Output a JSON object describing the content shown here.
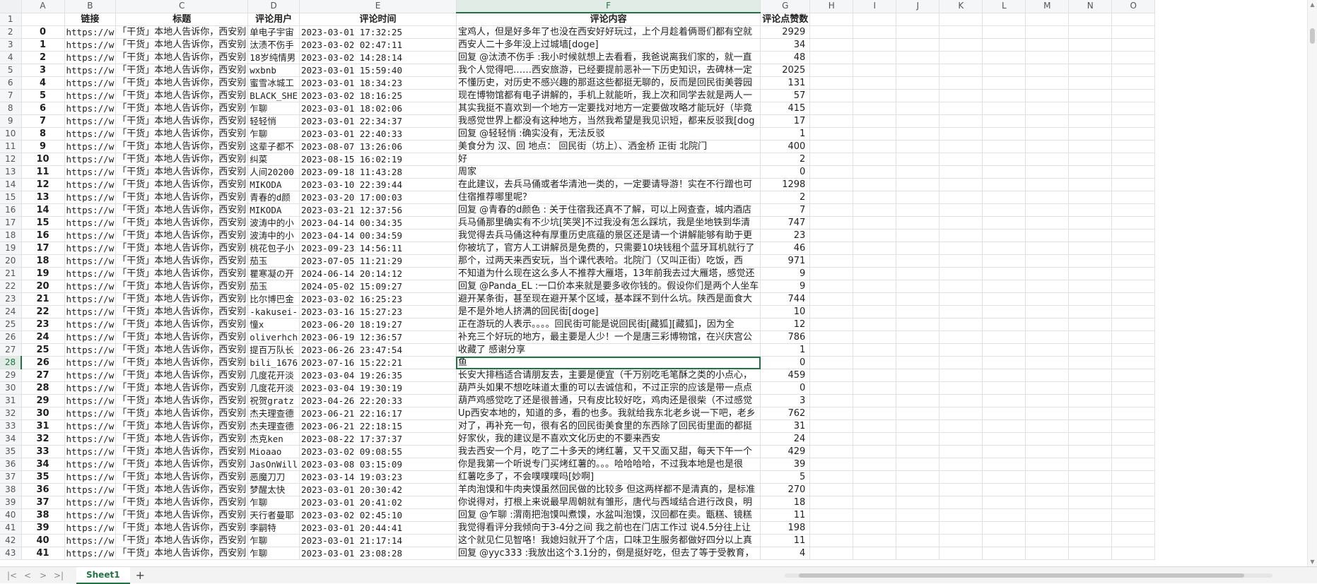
{
  "columns": [
    "A",
    "B",
    "C",
    "D",
    "E",
    "F",
    "G",
    "H",
    "I",
    "J",
    "K",
    "L",
    "M",
    "N",
    "O"
  ],
  "selected_column": "F",
  "selected_row": 28,
  "header": {
    "a": "",
    "link": "链接",
    "title": "标题",
    "user": "评论用户",
    "time": "评论时间",
    "content": "评论内容",
    "likes": "评论点赞数"
  },
  "rows": [
    {
      "r": 2,
      "a": "0",
      "b": "https://w",
      "c": "「干货」本地人告诉你，西安别",
      "d": "单电子宇宙",
      "e": "2023-03-01 17:32:25",
      "f": "宝鸡人，但是好多年了也没在西安好好玩过，上个月趁着俩哥们都有空就",
      "g": "2929"
    },
    {
      "r": 3,
      "a": "1",
      "b": "https://w",
      "c": "「干货」本地人告诉你，西安别",
      "d": "汰渍不伤手",
      "e": "2023-03-02 02:47:11",
      "f": "西安人二十多年没上过城墙[doge]",
      "g": "34"
    },
    {
      "r": 4,
      "a": "2",
      "b": "https://w",
      "c": "「干货」本地人告诉你，西安别",
      "d": "18岁纯情男",
      "e": "2023-03-02 14:28:14",
      "f": "回复 @汰渍不伤手 :我小时候就想上去看看，我爸说离我们家的，就一直",
      "g": "48"
    },
    {
      "r": 5,
      "a": "3",
      "b": "https://w",
      "c": "「干货」本地人告诉你，西安别",
      "d": "wxbnb",
      "e": "2023-03-01 15:59:40",
      "f": "我个人觉得吧……西安旅游，已经要提前恶补一下历史知识，去碑林一定",
      "g": "2025"
    },
    {
      "r": 6,
      "a": "4",
      "b": "https://w",
      "c": "「干货」本地人告诉你，西安别",
      "d": "蜜雪冰城工",
      "e": "2023-03-01 18:34:23",
      "f": "不懂历史，对历史不感兴趣的那逛这些都挺无聊的，反而是回民街美蓉园",
      "g": "131"
    },
    {
      "r": 7,
      "a": "5",
      "b": "https://w",
      "c": "「干货」本地人告诉你，西安别",
      "d": "BLACK_SHE",
      "e": "2023-03-02 18:16:25",
      "f": "现在博物馆都有电子讲解的，手机上就能听，我上次和同学去就是两人一",
      "g": "57"
    },
    {
      "r": 8,
      "a": "6",
      "b": "https://w",
      "c": "「干货」本地人告诉你，西安别",
      "d": "乍聊",
      "e": "2023-03-01 18:02:06",
      "f": "其实我挺不喜欢到一个地方一定要找对地方一定要做攻略才能玩好（毕竟",
      "g": "415"
    },
    {
      "r": 9,
      "a": "7",
      "b": "https://w",
      "c": "「干货」本地人告诉你，西安别",
      "d": "轻轻悄",
      "e": "2023-03-01 22:34:37",
      "f": "我感觉世界上都没有这种地方，当然我希望是我见识短，都来反驳我[dog",
      "g": "17"
    },
    {
      "r": 10,
      "a": "8",
      "b": "https://w",
      "c": "「干货」本地人告诉你，西安别",
      "d": "乍聊",
      "e": "2023-03-01 22:40:33",
      "f": "回复 @轻轻悄 :确实没有，无法反驳",
      "g": "1"
    },
    {
      "r": 11,
      "a": "9",
      "b": "https://w",
      "c": "「干货」本地人告诉你，西安别",
      "d": "这辈子都不",
      "e": "2023-08-07 13:26:06",
      "f": "美食分为 汉、回 地点： 回民街（坊上）、洒金桥   正街   北院门",
      "g": "400"
    },
    {
      "r": 12,
      "a": "10",
      "b": "https://w",
      "c": "「干货」本地人告诉你，西安别",
      "d": "纠菜",
      "e": "2023-08-15 16:02:19",
      "f": "好",
      "g": "2"
    },
    {
      "r": 13,
      "a": "11",
      "b": "https://w",
      "c": "「干货」本地人告诉你，西安别",
      "d": "人间20200",
      "e": "2023-09-18 11:43:28",
      "f": "周家",
      "g": "0"
    },
    {
      "r": 14,
      "a": "12",
      "b": "https://w",
      "c": "「干货」本地人告诉你，西安别",
      "d": "MIKODA",
      "e": "2023-03-10 22:39:44",
      "f": "在此建议，去兵马俑或者华清池一类的，一定要请导游！实在不行蹭也可",
      "g": "1298"
    },
    {
      "r": 15,
      "a": "13",
      "b": "https://w",
      "c": "「干货」本地人告诉你，西安别",
      "d": "青春的d颜",
      "e": "2023-03-20 17:00:03",
      "f": "住宿推荐哪里呢？",
      "g": "2"
    },
    {
      "r": 16,
      "a": "14",
      "b": "https://w",
      "c": "「干货」本地人告诉你，西安别",
      "d": "MIKODA",
      "e": "2023-03-21 12:37:56",
      "f": "回复 @青春的d颜色 : 关于住宿我还真不了解，可以上网查查，城内酒店",
      "g": "7"
    },
    {
      "r": 17,
      "a": "15",
      "b": "https://w",
      "c": "「干货」本地人告诉你，西安别",
      "d": "波涛中的小",
      "e": "2023-04-14 00:34:35",
      "f": "兵马俑那里确实有不少坑[笑哭]不过我没有怎么踩坑，我是坐地铁到华清",
      "g": "747"
    },
    {
      "r": 18,
      "a": "16",
      "b": "https://w",
      "c": "「干货」本地人告诉你，西安别",
      "d": "波涛中的小",
      "e": "2023-04-14 00:34:59",
      "f": "我觉得去兵马俑这种有厚重历史底蕴的景区还是请一个讲解能够有助于更",
      "g": "23"
    },
    {
      "r": 19,
      "a": "17",
      "b": "https://w",
      "c": "「干货」本地人告诉你，西安别",
      "d": "桃花包子小",
      "e": "2023-09-23 14:56:11",
      "f": "你被坑了，官方人工讲解员是免费的，只需要10块钱租个蓝牙耳机就行了",
      "g": "46"
    },
    {
      "r": 20,
      "a": "18",
      "b": "https://w",
      "c": "「干货」本地人告诉你，西安别",
      "d": "茄玉",
      "e": "2023-07-05 11:21:29",
      "f": "那个，过两天来西安玩，当个课代表哈。北院门（又叫正街）吃饭，西",
      "g": "971"
    },
    {
      "r": 21,
      "a": "19",
      "b": "https://w",
      "c": "「干货」本地人告诉你，西安别",
      "d": "瞿寒凝の开",
      "e": "2024-06-14 20:14:12",
      "f": "不知道为什么现在这么多人不推荐大雁塔，13年前我去过大雁塔，感觉还",
      "g": "9"
    },
    {
      "r": 22,
      "a": "20",
      "b": "https://w",
      "c": "「干货」本地人告诉你，西安别",
      "d": "茄玉",
      "e": "2024-05-02 15:09:27",
      "f": "回复 @Panda_EL :一口价本来就是要多收你钱的。假设你们是两个人坐车",
      "g": "9"
    },
    {
      "r": 23,
      "a": "21",
      "b": "https://w",
      "c": "「干货」本地人告诉你，西安别",
      "d": "比尔博巴金",
      "e": "2023-03-02 16:25:23",
      "f": "避开某条街，甚至现在避开某个区域，基本踩不到什么坑。陕西是面食大",
      "g": "744"
    },
    {
      "r": 24,
      "a": "22",
      "b": "https://w",
      "c": "「干货」本地人告诉你，西安别",
      "d": "-kakusei-",
      "e": "2023-03-16 15:27:23",
      "f": "是不是外地人挤满的回民街[doge]",
      "g": "10"
    },
    {
      "r": 25,
      "a": "23",
      "b": "https://w",
      "c": "「干货」本地人告诉你，西安别",
      "d": "憧x",
      "e": "2023-06-20 18:19:27",
      "f": "正在游玩的人表示。。。。回民街可能是说回民街[藏狐][藏狐]，因为全",
      "g": "12"
    },
    {
      "r": 26,
      "a": "24",
      "b": "https://w",
      "c": "「干货」本地人告诉你，西安别",
      "d": "oliverhch",
      "e": "2023-06-19 12:36:57",
      "f": "补充三个好玩的地方，最主要是人少！一个是唐三彩博物馆，在兴庆宫公",
      "g": "786"
    },
    {
      "r": 27,
      "a": "25",
      "b": "https://w",
      "c": "「干货」本地人告诉你，西安别",
      "d": "提百万队长",
      "e": "2023-06-26 23:47:54",
      "f": "收藏了  感谢分享",
      "g": "1"
    },
    {
      "r": 28,
      "a": "26",
      "b": "https://w",
      "c": "「干货」本地人告诉你，西安别",
      "d": "bili_1676",
      "e": "2023-07-16 15:22:21",
      "f": "鱼",
      "g": "0"
    },
    {
      "r": 29,
      "a": "27",
      "b": "https://w",
      "c": "「干货」本地人告诉你，西安别",
      "d": "几度花开淡",
      "e": "2023-03-04 19:26:35",
      "f": "长安大排档适合请朋友去，主要是便宜（千万别吃毛笔酥之类的小点心，",
      "g": "459"
    },
    {
      "r": 30,
      "a": "28",
      "b": "https://w",
      "c": "「干货」本地人告诉你，西安别",
      "d": "几度花开淡",
      "e": "2023-03-04 19:30:19",
      "f": "葫芦头如果不想吃味道太重的可以去诚信和，不过正宗的应该是带一点点",
      "g": "0"
    },
    {
      "r": 31,
      "a": "29",
      "b": "https://w",
      "c": "「干货」本地人告诉你，西安别",
      "d": "祝贺gratz",
      "e": "2023-04-26 22:20:33",
      "f": "葫芦鸡感觉吃了还是很普通，只有皮比较好吃，鸡肉还是很柴（不过感觉",
      "g": "3"
    },
    {
      "r": 32,
      "a": "30",
      "b": "https://w",
      "c": "「干货」本地人告诉你，西安别",
      "d": "杰夫理查德",
      "e": "2023-06-21 22:16:17",
      "f": "Up西安本地的，知道的多，看的也多。我就给我东北老乡说一下吧，老乡",
      "g": "762"
    },
    {
      "r": 33,
      "a": "31",
      "b": "https://w",
      "c": "「干货」本地人告诉你，西安别",
      "d": "杰夫理查德",
      "e": "2023-06-21 22:18:15",
      "f": "对了，再补充一句，很有名的回民街美食里的东西除了回民街里面的都挺",
      "g": "31"
    },
    {
      "r": 34,
      "a": "32",
      "b": "https://w",
      "c": "「干货」本地人告诉你，西安别",
      "d": "杰克ken",
      "e": "2023-08-22 17:37:37",
      "f": "好家伙，我的建议是不喜欢文化历史的不要来西安",
      "g": "24"
    },
    {
      "r": 35,
      "a": "33",
      "b": "https://w",
      "c": "「干货」本地人告诉你，西安别",
      "d": "Mioaao",
      "e": "2023-03-02 09:08:55",
      "f": "我去西安一个月，吃了二十多天的烤红薯，又干又面又甜，每天下午一个",
      "g": "429"
    },
    {
      "r": 36,
      "a": "34",
      "b": "https://w",
      "c": "「干货」本地人告诉你，西安别",
      "d": "JasOnWill",
      "e": "2023-03-08 03:15:09",
      "f": "你是我第一个听说专门买烤红薯的。。。哈哈哈哈，不过我本地是也是很",
      "g": "39"
    },
    {
      "r": 37,
      "a": "35",
      "b": "https://w",
      "c": "「干货」本地人告诉你，西安别",
      "d": "恶魔刀刀",
      "e": "2023-03-14 19:03:23",
      "f": "红薯吃多了，不会噗噗噗吗[妙啊]",
      "g": "5"
    },
    {
      "r": 38,
      "a": "36",
      "b": "https://w",
      "c": "「干货」本地人告诉你，西安别",
      "d": "梦醒太快",
      "e": "2023-03-01 20:30:42",
      "f": "羊肉泡馍和牛肉夹馍虽然回民做的比较多  但这两样都不是清真的，是标准",
      "g": "270"
    },
    {
      "r": 39,
      "a": "37",
      "b": "https://w",
      "c": "「干货」本地人告诉你，西安别",
      "d": "乍聊",
      "e": "2023-03-01 20:41:02",
      "f": "你说得对，打根上来说最早周朝就有雏形，唐代与西域结合进行改良，明",
      "g": "18"
    },
    {
      "r": 40,
      "a": "38",
      "b": "https://w",
      "c": "「干货」本地人告诉你，西安别",
      "d": "天行者曼耶",
      "e": "2023-03-02 02:45:10",
      "f": "回复 @乍聊 :渭南把泡馍叫煮馍，水盆叫泡馍，汉回都在卖。甑糕、镜糕",
      "g": "11"
    },
    {
      "r": 41,
      "a": "39",
      "b": "https://w",
      "c": "「干货」本地人告诉你，西安别",
      "d": "李嗣特",
      "e": "2023-03-01 20:44:41",
      "f": "我觉得看评分我倾向于3-4分之间 我之前也在门店工作过 说4.5分往上让",
      "g": "198"
    },
    {
      "r": 42,
      "a": "40",
      "b": "https://w",
      "c": "「干货」本地人告诉你，西安别",
      "d": "乍聊",
      "e": "2023-03-01 21:17:14",
      "f": "这个就见仁见智咯！我媳妇就开了个店，口味卫生服务都做好四分以上真",
      "g": "11"
    },
    {
      "r": 43,
      "a": "41",
      "b": "https://w",
      "c": "「干货」本地人告诉你，西安别",
      "d": "乍聊",
      "e": "2023-03-01 23:08:28",
      "f": "回复 @yyc333 :我放出这个3.1分的，倒是挺好吃，但去了等于受教育，",
      "g": "4"
    }
  ],
  "sheet_tab": "Sheet1",
  "add_sheet": "+",
  "nav": {
    "first": "|<",
    "prev": "<",
    "next": ">",
    "last": ">|"
  }
}
